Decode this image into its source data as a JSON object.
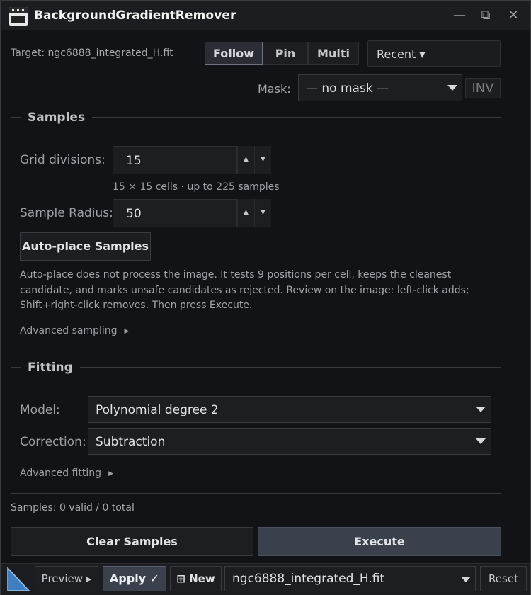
{
  "window": {
    "title": "BackgroundGradientRemover",
    "minimize_glyph": "—",
    "popout_glyph": "⧉",
    "close_glyph": "✕"
  },
  "top": {
    "target_label": "Target: ngc6888_integrated_H.fit",
    "modes": [
      {
        "label": "Follow",
        "active": true
      },
      {
        "label": "Pin",
        "active": false
      },
      {
        "label": "Multi",
        "active": false
      }
    ],
    "recent_label": "Recent ▾"
  },
  "mask": {
    "label": "Mask:",
    "value": "— no mask —",
    "invert_label": "INV"
  },
  "samples": {
    "title": "Samples",
    "grid_label": "Grid divisions:",
    "grid_value": "15",
    "grid_hint": "15 × 15 cells · up to 225 samples",
    "radius_label": "Sample Radius:",
    "radius_value": "50",
    "autoplace_label": "Auto-place Samples",
    "description": "Auto-place does not process the image. It tests 9 positions per cell, keeps the cleanest candidate, and marks unsafe candidates as rejected. Review on the image: left-click adds; Shift+right-click removes. Then press Execute.",
    "advanced_label": "Advanced sampling",
    "spin_up": "▲",
    "spin_down": "▼"
  },
  "fitting": {
    "title": "Fitting",
    "model_label": "Model:",
    "model_value": "Polynomial degree 2",
    "correction_label": "Correction:",
    "correction_value": "Subtraction",
    "advanced_label": "Advanced fitting"
  },
  "status": {
    "samples_count": "Samples: 0 valid / 0 total"
  },
  "actions": {
    "clear_label": "Clear Samples",
    "execute_label": "Execute"
  },
  "bottom": {
    "preview_label": "Preview ▸",
    "apply_label": "Apply ✓",
    "new_label": "⊞ New",
    "target_value": "ngc6888_integrated_H.fit",
    "reset_label": "Reset"
  },
  "colors": {
    "background": "#121316",
    "accent_execute": "#3a404c",
    "border": "#3a3b40",
    "logo_blue": "#3f7fc0"
  }
}
